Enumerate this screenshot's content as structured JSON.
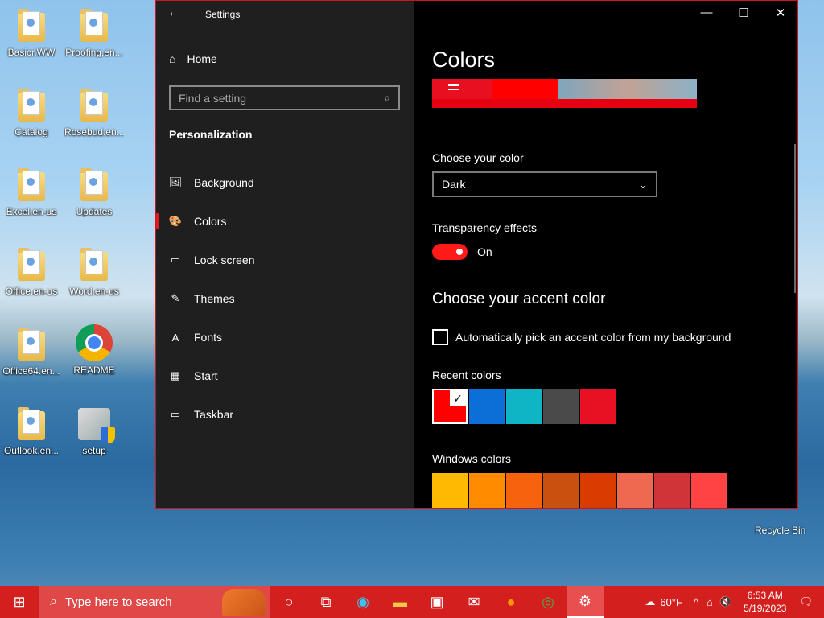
{
  "desktop": {
    "icons": [
      {
        "label": "Basicr.WW"
      },
      {
        "label": "Proofing.en..."
      },
      {
        "label": "Catalog"
      },
      {
        "label": "Rosebud.en..."
      },
      {
        "label": "Excel.en-us"
      },
      {
        "label": "Updates"
      },
      {
        "label": "Office.en-us"
      },
      {
        "label": "Word.en-us"
      },
      {
        "label": "Office64.en..."
      },
      {
        "label": "README"
      },
      {
        "label": "Outlook.en..."
      },
      {
        "label": "setup"
      }
    ],
    "recycle_bin": "Recycle Bin"
  },
  "window": {
    "title": "Settings",
    "back_icon": "←",
    "minimize_icon": "—",
    "maximize_icon": "☐",
    "close_icon": "✕"
  },
  "sidebar": {
    "home": "Home",
    "search_placeholder": "Find a setting",
    "section": "Personalization",
    "items": [
      {
        "label": "Background",
        "icon": "🖼"
      },
      {
        "label": "Colors",
        "icon": "🎨"
      },
      {
        "label": "Lock screen",
        "icon": "▭"
      },
      {
        "label": "Themes",
        "icon": "✎"
      },
      {
        "label": "Fonts",
        "icon": "A"
      },
      {
        "label": "Start",
        "icon": "▦"
      },
      {
        "label": "Taskbar",
        "icon": "▭"
      }
    ]
  },
  "main": {
    "title": "Colors",
    "choose_color_label": "Choose your color",
    "choose_color_value": "Dark",
    "transparency_label": "Transparency effects",
    "transparency_value": "On",
    "accent_heading": "Choose your accent color",
    "auto_pick_label": "Automatically pick an accent color from my background",
    "recent_label": "Recent colors",
    "recent_colors": [
      "#ff0000",
      "#0b6fd8",
      "#0fb5c5",
      "#4a4a4a",
      "#e81123"
    ],
    "windows_label": "Windows colors",
    "windows_colors": [
      "#ffb900",
      "#ff8c00",
      "#f7630c",
      "#ca5010",
      "#da3b01",
      "#ef6950",
      "#d13438",
      "#ff4343"
    ]
  },
  "taskbar": {
    "search_placeholder": "Type here to search",
    "weather": "60°F",
    "time": "6:53 AM",
    "date": "5/19/2023"
  },
  "colors": {
    "accent": "#e81123",
    "taskbar": "#d41f1f"
  }
}
